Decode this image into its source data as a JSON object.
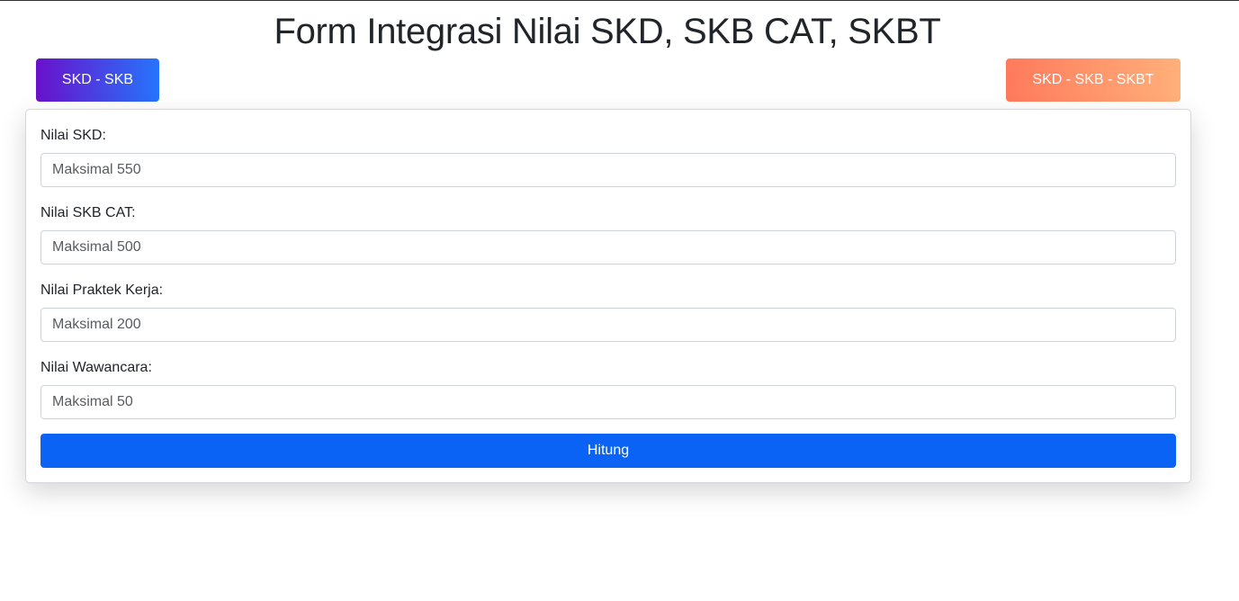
{
  "header": {
    "title": "Form Integrasi Nilai SKD, SKB CAT, SKBT"
  },
  "mode_buttons": {
    "skd_skb": "SKD - SKB",
    "skd_skb_skbt": "SKD - SKB - SKBT"
  },
  "form": {
    "fields": [
      {
        "label": "Nilai SKD:",
        "placeholder": "Maksimal 550",
        "value": ""
      },
      {
        "label": "Nilai SKB CAT:",
        "placeholder": "Maksimal 500",
        "value": ""
      },
      {
        "label": "Nilai Praktek Kerja:",
        "placeholder": "Maksimal 200",
        "value": ""
      },
      {
        "label": "Nilai Wawancara:",
        "placeholder": "Maksimal 50",
        "value": ""
      }
    ],
    "submit_label": "Hitung"
  },
  "colors": {
    "primary": "#0b63f6",
    "gradient_left_start": "#6a11cb",
    "gradient_left_end": "#2575fc",
    "gradient_right_start": "#ff7a5c",
    "gradient_right_end": "#ffb07a"
  }
}
